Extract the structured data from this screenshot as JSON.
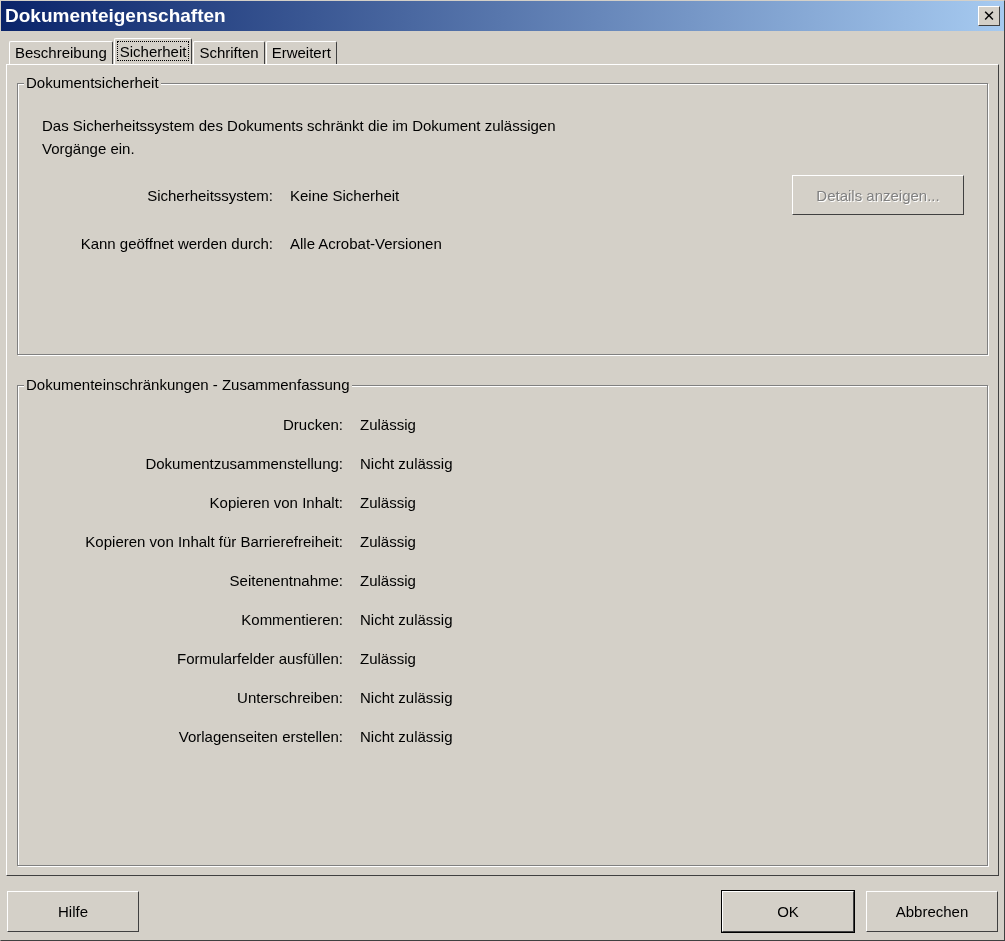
{
  "window": {
    "title": "Dokumenteigenschaften",
    "close": "✕"
  },
  "tabs": [
    {
      "label": "Beschreibung",
      "selected": false
    },
    {
      "label": "Sicherheit",
      "selected": true
    },
    {
      "label": "Schriften",
      "selected": false
    },
    {
      "label": "Erweitert",
      "selected": false
    }
  ],
  "security": {
    "title": "Dokumentsicherheit",
    "description": "Das Sicherheitssystem des Dokuments schränkt die im Dokument zulässigen Vorgänge ein.",
    "fields": [
      {
        "label": "Sicherheitssystem:",
        "value": "Keine Sicherheit"
      },
      {
        "label": "Kann geöffnet werden durch:",
        "value": "Alle Acrobat-Versionen"
      }
    ],
    "details_button": {
      "label": "Details anzeigen...",
      "disabled": true
    }
  },
  "restrictions": {
    "title": "Dokumenteinschränkungen - Zusammenfassung",
    "rows": [
      {
        "label": "Drucken:",
        "value": "Zulässig"
      },
      {
        "label": "Dokumentzusammenstellung:",
        "value": "Nicht zulässig"
      },
      {
        "label": "Kopieren von Inhalt:",
        "value": "Zulässig"
      },
      {
        "label": "Kopieren von Inhalt für Barrierefreiheit:",
        "value": "Zulässig"
      },
      {
        "label": "Seitenentnahme:",
        "value": "Zulässig"
      },
      {
        "label": "Kommentieren:",
        "value": "Nicht zulässig"
      },
      {
        "label": "Formularfelder ausfüllen:",
        "value": "Zulässig"
      },
      {
        "label": "Unterschreiben:",
        "value": "Nicht zulässig"
      },
      {
        "label": "Vorlagenseiten erstellen:",
        "value": "Nicht zulässig"
      }
    ]
  },
  "buttons": [
    {
      "label": "Hilfe",
      "kind": "left",
      "default": false
    },
    {
      "label": "OK",
      "kind": "right",
      "default": true
    },
    {
      "label": "Abbrechen",
      "kind": "right",
      "default": false
    }
  ]
}
